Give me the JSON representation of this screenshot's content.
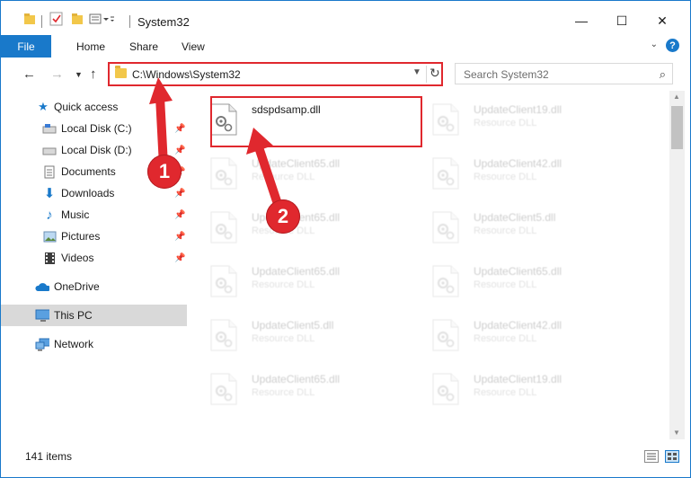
{
  "window": {
    "title": "System32",
    "minimize": "—",
    "maximize": "☐",
    "close": "✕"
  },
  "ribbon": {
    "file": "File",
    "home": "Home",
    "share": "Share",
    "view": "View",
    "help": "?"
  },
  "address": {
    "path": "C:\\Windows\\System32"
  },
  "search": {
    "placeholder": "Search System32"
  },
  "sidebar": {
    "items": [
      {
        "label": "Quick access",
        "icon": "star-icon",
        "pinned": false
      },
      {
        "label": "Local Disk (C:)",
        "icon": "drive-icon",
        "pinned": true
      },
      {
        "label": "Local Disk (D:)",
        "icon": "drive-icon",
        "pinned": true
      },
      {
        "label": "Documents",
        "icon": "documents-icon",
        "pinned": true
      },
      {
        "label": "Downloads",
        "icon": "downloads-icon",
        "pinned": true
      },
      {
        "label": "Music",
        "icon": "music-icon",
        "pinned": true
      },
      {
        "label": "Pictures",
        "icon": "pictures-icon",
        "pinned": true
      },
      {
        "label": "Videos",
        "icon": "videos-icon",
        "pinned": true
      },
      {
        "label": "OneDrive",
        "icon": "onedrive-icon",
        "pinned": false
      },
      {
        "label": "This PC",
        "icon": "pc-icon",
        "pinned": false,
        "selected": true
      },
      {
        "label": "Network",
        "icon": "network-icon",
        "pinned": false
      }
    ]
  },
  "files": [
    {
      "name": "sdspdsamp.dll",
      "desc": "",
      "highlighted": true
    },
    {
      "name": "UpdateClient19.dll",
      "desc": "Resource DLL"
    },
    {
      "name": "UpdateClient65.dll",
      "desc": "Resource DLL"
    },
    {
      "name": "UpdateClient42.dll",
      "desc": "Resource DLL"
    },
    {
      "name": "UpdateClient65.dll",
      "desc": "Resource DLL"
    },
    {
      "name": "UpdateClient5.dll",
      "desc": "Resource DLL"
    },
    {
      "name": "UpdateClient65.dll",
      "desc": "Resource DLL"
    },
    {
      "name": "UpdateClient65.dll",
      "desc": "Resource DLL"
    },
    {
      "name": "UpdateClient5.dll",
      "desc": "Resource DLL"
    },
    {
      "name": "UpdateClient42.dll",
      "desc": "Resource DLL"
    },
    {
      "name": "UpdateClient65.dll",
      "desc": "Resource DLL"
    },
    {
      "name": "UpdateClient19.dll",
      "desc": "Resource DLL"
    }
  ],
  "status": {
    "items": "141 items"
  },
  "callouts": {
    "step1": "1",
    "step2": "2"
  },
  "colors": {
    "accent": "#1979ca",
    "highlight": "#e0282e"
  }
}
